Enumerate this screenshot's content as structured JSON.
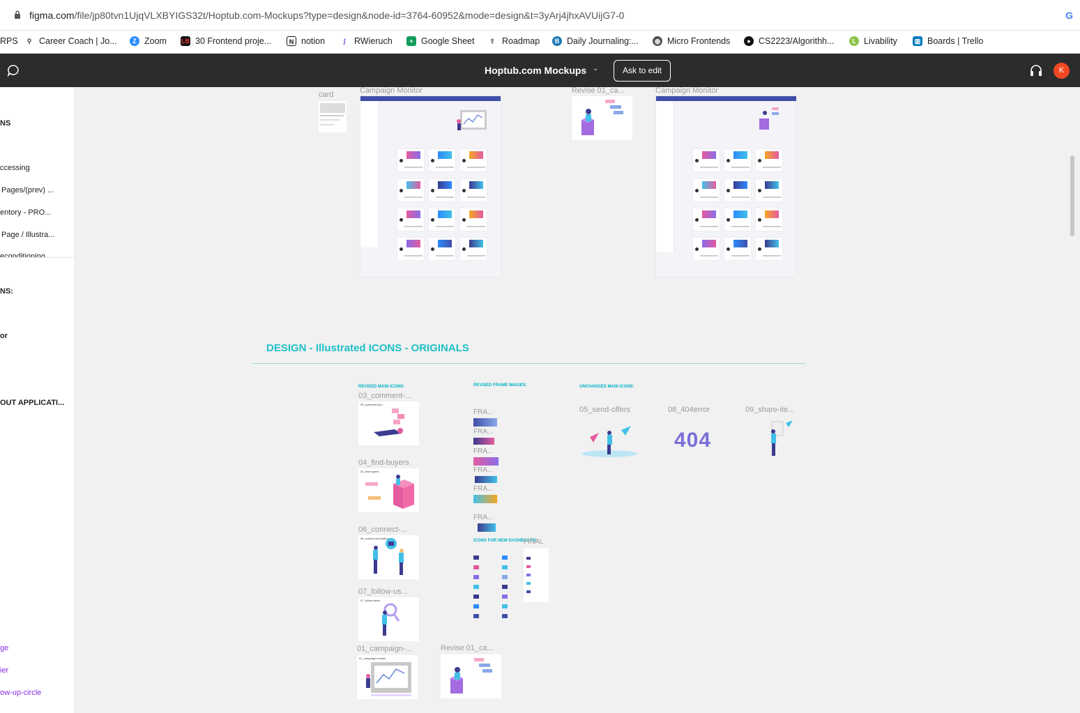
{
  "browser": {
    "url_host": "figma.com",
    "url_path": "/file/jp80tvn1UjqVLXBYIGS32t/Hoptub.com-Mockups?type=design&node-id=3764-60952&mode=design&t=3yArj4jhxAVUijG7-0",
    "google_icon": "G"
  },
  "bookmarks": [
    {
      "label": "RPS",
      "icon": ""
    },
    {
      "label": "Career Coach | Jo...",
      "icon": "people-icon"
    },
    {
      "label": "Zoom",
      "icon": "zoom-icon"
    },
    {
      "label": "30 Frontend proje...",
      "icon": "lb-icon"
    },
    {
      "label": "notion",
      "icon": "notion-icon"
    },
    {
      "label": "RWieruch",
      "icon": "rw-icon"
    },
    {
      "label": "Google Sheet",
      "icon": "sheets-icon"
    },
    {
      "label": "Roadmap",
      "icon": "rocket-icon"
    },
    {
      "label": "Daily Journaling:...",
      "icon": "b-icon"
    },
    {
      "label": "Micro Frontends",
      "icon": "globe-icon"
    },
    {
      "label": "CS2223/Algorithh...",
      "icon": "github-icon"
    },
    {
      "label": "Livability",
      "icon": "livability-icon"
    },
    {
      "label": "Boards | Trello",
      "icon": "trello-icon"
    }
  ],
  "topbar": {
    "file_title": "Hoptub.com Mockups",
    "ask_to_edit": "Ask to edit",
    "avatar_initial": "K"
  },
  "left_panel": {
    "items": [
      {
        "label": "NS",
        "style": "bold"
      },
      {
        "label": "ccessing",
        "style": "normal"
      },
      {
        "label": "Pages/(prev) ...",
        "style": "normal"
      },
      {
        "label": "entory - PRO...",
        "style": "normal"
      },
      {
        "label": "Page / Illustra...",
        "style": "normal"
      },
      {
        "label": "econditioning",
        "style": "normal"
      },
      {
        "label": "NS:",
        "style": "bold"
      },
      {
        "label": "or",
        "style": "bold"
      },
      {
        "label": "OUT APPLICATI...",
        "style": "bold"
      },
      {
        "label": "ge",
        "style": "purple"
      },
      {
        "label": "ier",
        "style": "purple"
      },
      {
        "label": "ow-up-circle",
        "style": "purple"
      }
    ]
  },
  "canvas": {
    "top_frames": {
      "card_label": "card",
      "campaign_monitor_1": "Campaign Monitor",
      "revise_label": "Revise 01_ca...",
      "campaign_monitor_2": "Campaign Monitor"
    },
    "section_title": "DESIGN - Illustrated ICONS - ORIGINALS",
    "headers": {
      "revised_main": "REVISED MAIN ICONS:",
      "revised_frame": "REVISED FRAME IMAGES:",
      "unchanged_main": "UNCHANGED MAIN ICONS:",
      "icons_new_dashboard": "ICONS FOR NEW DASHBOARD",
      "final": "FINAL"
    },
    "revised_icons": [
      {
        "label": "03_comment-...",
        "inner": "03_comment icon"
      },
      {
        "label": "04_find-buyers",
        "inner": "04_find buyers"
      },
      {
        "label": "06_connect-...",
        "inner": "06_connect-w-trusted-con"
      },
      {
        "label": "07_follow-us...",
        "inner": "07_follow users"
      },
      {
        "label": "01_campaign-...",
        "inner": "01_campaign monitor"
      }
    ],
    "revise_bottom_label": "Revise 01_ca...",
    "frame_images": [
      "FRA...",
      "FRA...",
      "FRA...",
      "FRA...",
      "FRA...",
      "FRA..."
    ],
    "unchanged_icons": [
      {
        "label": "05_send-offers"
      },
      {
        "label": "08_404error",
        "text": "404"
      },
      {
        "label": "09_share-ite..."
      }
    ]
  }
}
